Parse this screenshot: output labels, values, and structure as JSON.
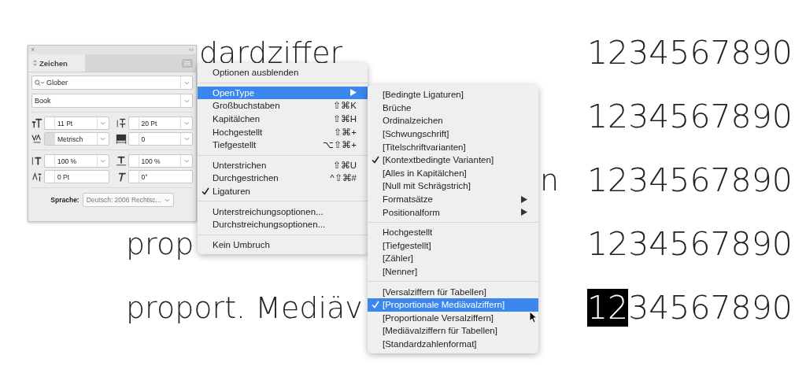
{
  "document": {
    "rows": [
      {
        "label": "dardziffer",
        "kind": "after_panel",
        "digits": [
          {
            "text": "1234567890",
            "selected": false
          }
        ]
      },
      {
        "kind": "plain",
        "digits": [
          {
            "text": "1234567890",
            "selected": false
          }
        ]
      },
      {
        "label": "n",
        "kind": "before_menu",
        "digits": [
          {
            "text": "1234567890",
            "selected": false
          }
        ]
      },
      {
        "label": "prop",
        "kind": "plain",
        "digits": [
          {
            "text": "1234567890",
            "selected": false
          }
        ]
      },
      {
        "label": "proport. Mediäv",
        "kind": "plain",
        "digits": [
          {
            "text": "12",
            "selected": true
          },
          {
            "text": "34567890",
            "selected": false
          }
        ]
      }
    ]
  },
  "panel": {
    "close": "×",
    "collapse": "‹‹",
    "tab": {
      "label": "Zeichen",
      "selected": true
    },
    "font_family": "Glober",
    "font_style": "Book",
    "controls": [
      {
        "value": "11 Pt",
        "dropdown": true,
        "stepper_disabled": false
      },
      {
        "value": "20 Pt",
        "dropdown": true,
        "stepper_disabled": false
      },
      {
        "value": "Metrisch",
        "dropdown": true,
        "stepper_disabled": true
      },
      {
        "value": "0",
        "dropdown": true,
        "stepper_disabled": false
      },
      {
        "value": "100 %",
        "dropdown": true,
        "stepper_disabled": false
      },
      {
        "value": "100 %",
        "dropdown": true,
        "stepper_disabled": false
      },
      {
        "value": "0 Pt",
        "dropdown": false,
        "stepper_disabled": false
      },
      {
        "value": "0°",
        "dropdown": false,
        "stepper_disabled": false
      }
    ],
    "language_label": "Sprache:",
    "language": "Deutsch: 2006 Rechtsc..."
  },
  "menu": [
    {
      "kind": "item",
      "label": "Optionen ausblenden",
      "checked": false,
      "submenu": false,
      "selected": false
    },
    {
      "kind": "separator"
    },
    {
      "kind": "item",
      "label": "OpenType",
      "checked": false,
      "submenu": true,
      "selected": true
    },
    {
      "kind": "item",
      "label": "Großbuchstaben",
      "shortcut": "⇧⌘K",
      "checked": false,
      "submenu": false,
      "selected": false
    },
    {
      "kind": "item",
      "label": "Kapitälchen",
      "shortcut": "⇧⌘H",
      "checked": false,
      "submenu": false,
      "selected": false
    },
    {
      "kind": "item",
      "label": "Hochgestellt",
      "shortcut": "⇧⌘+",
      "checked": false,
      "submenu": false,
      "selected": false
    },
    {
      "kind": "item",
      "label": "Tiefgestellt",
      "shortcut": "⌥⇧⌘+",
      "checked": false,
      "submenu": false,
      "selected": false
    },
    {
      "kind": "separator"
    },
    {
      "kind": "item",
      "label": "Unterstrichen",
      "shortcut": "⇧⌘U",
      "checked": false,
      "submenu": false,
      "selected": false
    },
    {
      "kind": "item",
      "label": "Durchgestrichen",
      "shortcut": "^⇧⌘#",
      "checked": false,
      "submenu": false,
      "selected": false
    },
    {
      "kind": "item",
      "label": "Ligaturen",
      "checked": true,
      "submenu": false,
      "selected": false
    },
    {
      "kind": "separator"
    },
    {
      "kind": "item",
      "label": "Unterstreichungsoptionen...",
      "checked": false,
      "submenu": false,
      "selected": false
    },
    {
      "kind": "item",
      "label": "Durchstreichungsoptionen...",
      "checked": false,
      "submenu": false,
      "selected": false
    },
    {
      "kind": "separator"
    },
    {
      "kind": "item",
      "label": "Kein Umbruch",
      "checked": false,
      "submenu": false,
      "selected": false
    }
  ],
  "submenu": [
    {
      "kind": "item",
      "label": "[Bedingte Ligaturen]",
      "checked": false,
      "submenu": false,
      "selected": false
    },
    {
      "kind": "item",
      "label": "Brüche",
      "checked": false,
      "submenu": false,
      "selected": false
    },
    {
      "kind": "item",
      "label": "Ordinalzeichen",
      "checked": false,
      "submenu": false,
      "selected": false
    },
    {
      "kind": "item",
      "label": "[Schwungschrift]",
      "checked": false,
      "submenu": false,
      "selected": false
    },
    {
      "kind": "item",
      "label": "[Titelschriftvarianten]",
      "checked": false,
      "submenu": false,
      "selected": false
    },
    {
      "kind": "item",
      "label": "[Kontextbedingte Varianten]",
      "checked": true,
      "submenu": false,
      "selected": false
    },
    {
      "kind": "item",
      "label": "[Alles in Kapitälchen]",
      "checked": false,
      "submenu": false,
      "selected": false
    },
    {
      "kind": "item",
      "label": "[Null mit Schrägstrich]",
      "checked": false,
      "submenu": false,
      "selected": false
    },
    {
      "kind": "item",
      "label": "Formatsätze",
      "checked": false,
      "submenu": true,
      "selected": false
    },
    {
      "kind": "item",
      "label": "Positionalform",
      "checked": false,
      "submenu": true,
      "selected": false
    },
    {
      "kind": "separator"
    },
    {
      "kind": "item",
      "label": "Hochgestellt",
      "checked": false,
      "submenu": false,
      "selected": false
    },
    {
      "kind": "item",
      "label": "[Tiefgestellt]",
      "checked": false,
      "submenu": false,
      "selected": false
    },
    {
      "kind": "item",
      "label": "[Zähler]",
      "checked": false,
      "submenu": false,
      "selected": false
    },
    {
      "kind": "item",
      "label": "[Nenner]",
      "checked": false,
      "submenu": false,
      "selected": false
    },
    {
      "kind": "separator"
    },
    {
      "kind": "item",
      "label": "[Versalziffern für Tabellen]",
      "checked": false,
      "submenu": false,
      "selected": false
    },
    {
      "kind": "item",
      "label": "[Proportionale Mediävalziffern]",
      "checked": true,
      "submenu": false,
      "selected": true
    },
    {
      "kind": "item",
      "label": "[Proportionale Versalziffern]",
      "checked": false,
      "submenu": false,
      "selected": false
    },
    {
      "kind": "item",
      "label": "[Mediävalziffern für Tabellen]",
      "checked": false,
      "submenu": false,
      "selected": false
    },
    {
      "kind": "item",
      "label": "[Standardzahlenformat]",
      "checked": false,
      "submenu": false,
      "selected": false
    }
  ]
}
